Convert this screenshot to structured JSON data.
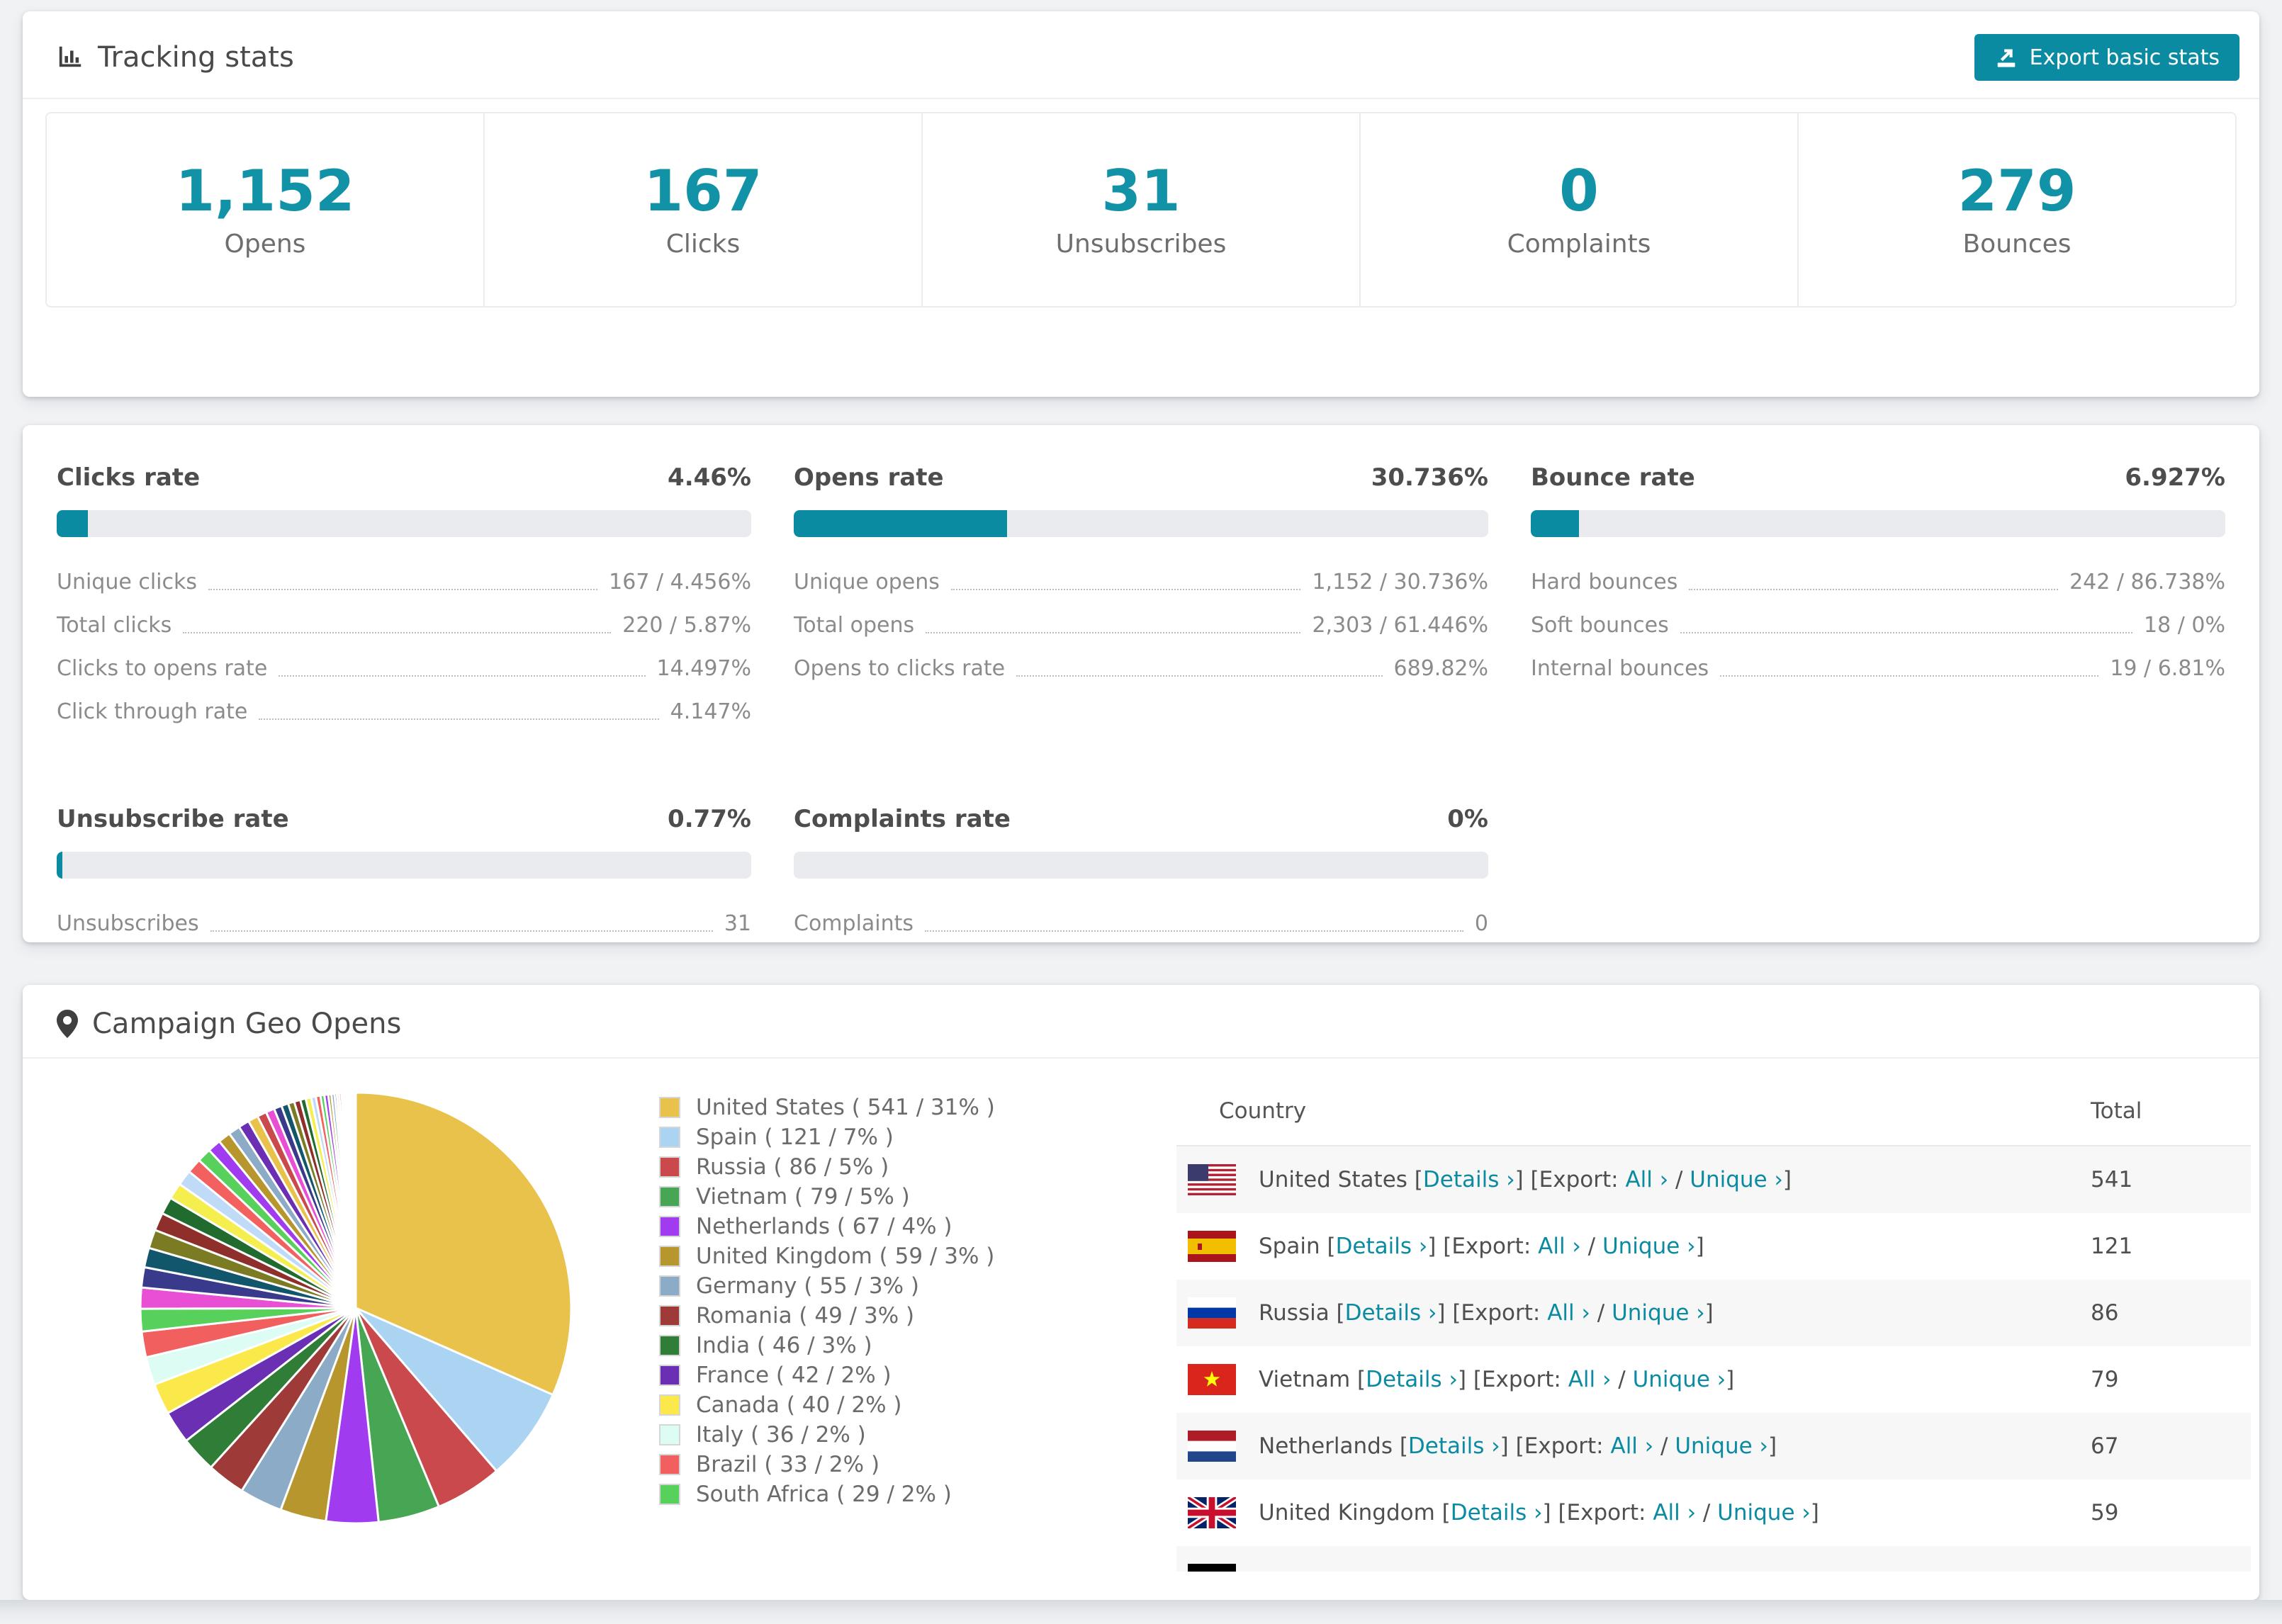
{
  "accent_color": "#0b8ba1",
  "bar_track_color": "#e9ebee",
  "header": {
    "title": "Tracking stats",
    "export_label": "Export basic stats"
  },
  "summary": [
    {
      "label": "Opens",
      "value": "1,152"
    },
    {
      "label": "Clicks",
      "value": "167"
    },
    {
      "label": "Unsubscribes",
      "value": "31"
    },
    {
      "label": "Complaints",
      "value": "0"
    },
    {
      "label": "Bounces",
      "value": "279"
    }
  ],
  "rates": [
    {
      "title": "Clicks rate",
      "value": "4.46%",
      "percent": 4.46,
      "rows": [
        {
          "label": "Unique clicks",
          "value": "167 / 4.456%"
        },
        {
          "label": "Total clicks",
          "value": "220 / 5.87%"
        },
        {
          "label": "Clicks to opens rate",
          "value": "14.497%"
        },
        {
          "label": "Click through rate",
          "value": "4.147%"
        }
      ]
    },
    {
      "title": "Opens rate",
      "value": "30.736%",
      "percent": 30.736,
      "rows": [
        {
          "label": "Unique opens",
          "value": "1,152 / 30.736%"
        },
        {
          "label": "Total opens",
          "value": "2,303 / 61.446%"
        },
        {
          "label": "Opens to clicks rate",
          "value": "689.82%"
        }
      ]
    },
    {
      "title": "Bounce rate",
      "value": "6.927%",
      "percent": 6.927,
      "rows": [
        {
          "label": "Hard bounces",
          "value": "242 / 86.738%"
        },
        {
          "label": "Soft bounces",
          "value": "18 / 0%"
        },
        {
          "label": "Internal bounces",
          "value": "19 / 6.81%"
        }
      ]
    },
    {
      "title": "Unsubscribe rate",
      "value": "0.77%",
      "percent": 0.77,
      "rows": [
        {
          "label": "Unsubscribes",
          "value": "31"
        }
      ]
    },
    {
      "title": "Complaints rate",
      "value": "0%",
      "percent": 0,
      "rows": [
        {
          "label": "Complaints",
          "value": "0"
        }
      ]
    }
  ],
  "geo": {
    "title": "Campaign Geo Opens",
    "chart_data": {
      "type": "pie",
      "title": "Campaign Geo Opens",
      "legend_position": "right",
      "labels": [
        "United States",
        "Spain",
        "Russia",
        "Vietnam",
        "Netherlands",
        "United Kingdom",
        "Germany",
        "Romania",
        "India",
        "France",
        "Canada",
        "Italy",
        "Brazil",
        "South Africa"
      ],
      "values": [
        541,
        121,
        86,
        79,
        67,
        59,
        55,
        49,
        46,
        42,
        40,
        36,
        33,
        29
      ],
      "percents": [
        31,
        7,
        5,
        5,
        4,
        3,
        3,
        3,
        3,
        2,
        2,
        2,
        2,
        2
      ],
      "colors": [
        "#e8c24a",
        "#abd3f2",
        "#c9494d",
        "#47a653",
        "#a03bf0",
        "#b8962e",
        "#8cabc6",
        "#9e3a37",
        "#2f7d36",
        "#6a2fb3",
        "#fbe84a",
        "#dcfcf4",
        "#f15f5f",
        "#57d05c"
      ],
      "others_values": [
        27,
        26,
        25,
        24,
        23,
        22,
        21,
        20,
        19,
        18,
        17,
        16,
        15,
        14,
        13,
        12,
        11,
        10,
        9,
        8,
        8,
        7,
        7,
        6,
        6,
        5,
        5,
        4,
        4,
        3,
        3,
        3,
        2,
        2,
        2,
        2,
        1,
        1,
        1,
        1,
        1,
        1,
        1,
        1,
        1,
        1
      ],
      "others_palette": [
        "#e84fd4",
        "#3a3a8c",
        "#11566b",
        "#7b7b24",
        "#8e2f2c",
        "#226b2f",
        "#f4ef4f",
        "#bfdbf7",
        "#f26060",
        "#57d05c",
        "#a13bf0",
        "#b8962e",
        "#8cabc6",
        "#6a2fb3",
        "#e8c24a",
        "#c9494d"
      ]
    },
    "legend_format": {
      "open": " ( ",
      "sep": " / ",
      "close": "% )"
    },
    "table": {
      "headers": [
        "Country",
        "Total"
      ],
      "links": {
        "open": " [",
        "details": "Details ›",
        "mid": "] [Export: ",
        "all": "All ›",
        "sep": " / ",
        "unique": "Unique ›",
        "close": "]"
      },
      "rows": [
        {
          "flag": "us",
          "country": "United States",
          "total": "541"
        },
        {
          "flag": "es",
          "country": "Spain",
          "total": "121"
        },
        {
          "flag": "ru",
          "country": "Russia",
          "total": "86"
        },
        {
          "flag": "vn",
          "country": "Vietnam",
          "total": "79"
        },
        {
          "flag": "nl",
          "country": "Netherlands",
          "total": "67"
        },
        {
          "flag": "gb",
          "country": "United Kingdom",
          "total": "59"
        },
        {
          "flag": "de",
          "country": "",
          "total": ""
        }
      ]
    }
  }
}
